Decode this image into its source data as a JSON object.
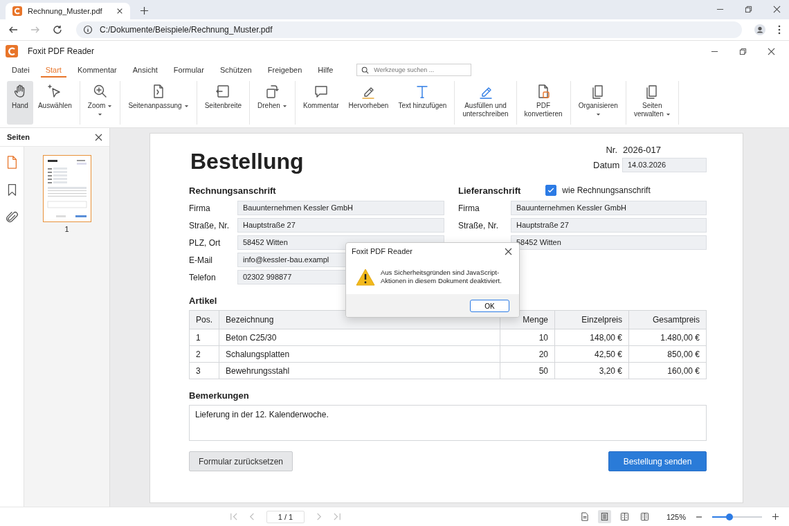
{
  "browser": {
    "tab": {
      "title": "Rechnung_Muster.pdf"
    },
    "address": "C:/Dokumente/Beispiele/Rechnung_Muster.pdf"
  },
  "app": {
    "title": "Foxit PDF Reader"
  },
  "menu": [
    {
      "label": "Datei",
      "selected": false
    },
    {
      "label": "Start",
      "selected": true
    },
    {
      "label": "Kommentar",
      "selected": false
    },
    {
      "label": "Ansicht",
      "selected": false
    },
    {
      "label": "Formular",
      "selected": false
    },
    {
      "label": "Schützen",
      "selected": false
    },
    {
      "label": "Freigeben",
      "selected": false
    },
    {
      "label": "Hilfe",
      "selected": false
    }
  ],
  "search": {
    "placeholder": "Werkzeuge suchen ..."
  },
  "ribbon": [
    [
      {
        "label": "Hand",
        "kind": "hand",
        "dropdown": false,
        "split": false,
        "selected": true
      },
      {
        "label": "Auswählen",
        "kind": "cursor",
        "dropdown": false,
        "split": false,
        "selected": false
      }
    ],
    [
      {
        "label": "Zoom",
        "kind": "zoom",
        "dropdown": true,
        "split": true,
        "selected": false
      }
    ],
    [
      {
        "label": "Seitenanpassung",
        "kind": "fitpage",
        "dropdown": true,
        "split": false,
        "selected": false
      }
    ],
    [
      {
        "label": "Seitenbreite",
        "kind": "fitwidth",
        "dropdown": false,
        "split": false,
        "selected": false
      }
    ],
    [
      {
        "label": "Drehen",
        "kind": "rotate",
        "dropdown": true,
        "split": false,
        "selected": false
      }
    ],
    [
      {
        "label": "Kommentar",
        "kind": "comment",
        "dropdown": false,
        "split": false,
        "selected": false
      },
      {
        "label": "Hervorheben",
        "kind": "highlight",
        "dropdown": false,
        "split": false,
        "selected": false
      },
      {
        "label": "Text hinzufügen",
        "kind": "text",
        "dropdown": false,
        "split": false,
        "selected": false
      }
    ],
    [
      {
        "label": "Ausfüllen und\nunterschreiben",
        "kind": "sign",
        "dropdown": false,
        "split": false,
        "selected": false
      }
    ],
    [
      {
        "label": "PDF\nkonvertieren",
        "kind": "convert",
        "dropdown": false,
        "split": false,
        "selected": false
      }
    ],
    [
      {
        "label": "Organisieren",
        "kind": "pages",
        "dropdown": false,
        "split": true,
        "selected": false
      }
    ],
    [
      {
        "label": "Seiten\nverwalten",
        "kind": "pages",
        "dropdown": true,
        "split": false,
        "selected": false
      }
    ]
  ],
  "sidebar": {
    "title": "Seiten",
    "tabs": [
      {
        "kind": "page",
        "selected": true
      },
      {
        "kind": "bookmark",
        "selected": false
      },
      {
        "kind": "attachment",
        "selected": false
      }
    ],
    "thumbnails": [
      {
        "label": "1",
        "selected": true
      }
    ]
  },
  "document": {
    "title": "Bestellung",
    "number_label": "Nr.",
    "number": "2026-017",
    "date_label": "Datum",
    "date": "14.03.2026",
    "billing": {
      "heading": "Rechnungsanschrift",
      "fields": [
        {
          "label": "Firma",
          "value": "Bauunternehmen Kessler GmbH"
        },
        {
          "label": "Straße, Nr.",
          "value": "Hauptstraße 27"
        },
        {
          "label": "PLZ, Ort",
          "value": "58452 Witten"
        },
        {
          "label": "E-Mail",
          "value": "info@kessler-bau.exampl"
        },
        {
          "label": "Telefon",
          "value": "02302 998877"
        }
      ]
    },
    "shipping": {
      "heading": "Lieferanschrift",
      "same_as_billing": {
        "label": "wie Rechnungsanschrift",
        "checked": true
      },
      "fields": [
        {
          "label": "Firma",
          "value": "Bauunternehmen Kessler GmbH"
        },
        {
          "label": "Straße, Nr.",
          "value": "Hauptstraße 27"
        },
        {
          "value": "58452 Witten"
        }
      ]
    },
    "articles": {
      "heading": "Artikel",
      "columns": [
        "Pos.",
        "Bezeichnung",
        "Menge",
        "Einzelpreis",
        "Gesamtpreis"
      ],
      "rows": [
        [
          "1",
          "Beton C25/30",
          "10",
          "148,00 €",
          "1.480,00 €"
        ],
        [
          "2",
          "Schalungsplatten",
          "20",
          "42,50 €",
          "850,00 €"
        ],
        [
          "3",
          "Bewehrungsstahl",
          "50",
          "3,20 €",
          "160,00 €"
        ]
      ]
    },
    "remarks": {
      "heading": "Bemerkungen",
      "value": "Lieferung in der 12. Kalenderwoche."
    },
    "buttons": [
      {
        "label": "Formular zurücksetzen",
        "kind": "secondary"
      },
      {
        "label": "Bestellung senden",
        "kind": "primary"
      }
    ]
  },
  "dialog": {
    "title": "Foxit PDF Reader",
    "message": "Aus Sicherheitsgründen sind JavaScript-Aktionen in diesem Dokument deaktiviert.",
    "buttons": [
      "OK"
    ]
  },
  "status_bar": {
    "nav": [
      {
        "kind": "first",
        "disabled": true
      },
      {
        "kind": "prev",
        "disabled": true
      }
    ],
    "page": "1 / 1",
    "nav_after": [
      {
        "kind": "next",
        "disabled": true
      },
      {
        "kind": "last",
        "disabled": true
      }
    ],
    "views": [
      {
        "kind": "single",
        "selected": false
      },
      {
        "kind": "continuous",
        "selected": true
      },
      {
        "kind": "facing",
        "selected": false
      },
      {
        "kind": "facing-continuous",
        "selected": false
      }
    ],
    "zoom": "125%",
    "zoom_slider": {
      "level": 0.35
    }
  }
}
